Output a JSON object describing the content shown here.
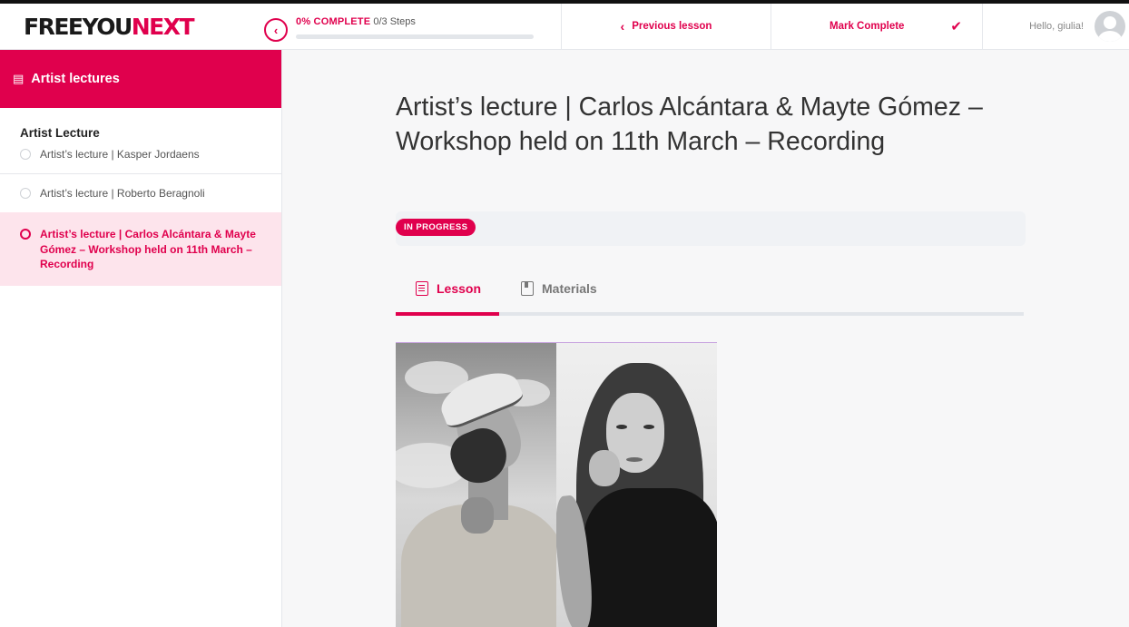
{
  "brand": {
    "logo_part1": "FREEYOU",
    "logo_part2": "NEXT"
  },
  "header": {
    "progress_percent_label": "0% COMPLETE",
    "progress_steps": "0/3 Steps",
    "progress_value": 0,
    "previous_label": "Previous lesson",
    "previous_icon": "chevron-left-icon",
    "mark_complete_label": "Mark Complete",
    "mark_complete_icon": "check-icon",
    "greeting": "Hello, giulia!",
    "avatar_icon": "user-avatar-icon"
  },
  "sidebar": {
    "header_title": "Artist lectures",
    "header_icon": "document-icon",
    "collapse_icon": "chevron-left-icon",
    "section_title": "Artist Lecture",
    "items": [
      {
        "label": "Artist’s lecture | Kasper Jordaens",
        "active": false
      },
      {
        "label": "Artist’s lecture | Roberto Beragnoli",
        "active": false
      },
      {
        "label": "Artist’s lecture | Carlos Alcántara & Mayte Gómez – Workshop held on 11th March – Recording",
        "active": true
      }
    ]
  },
  "main": {
    "title": "Artist’s lecture | Carlos Alcántara & Mayte Gómez – Workshop held on 11th March – Recording",
    "status_badge": "IN PROGRESS",
    "tabs": [
      {
        "label": "Lesson",
        "icon": "document-icon",
        "active": true
      },
      {
        "label": "Materials",
        "icon": "bookmark-icon",
        "active": false
      }
    ],
    "image_icon": "artist-photo"
  },
  "colors": {
    "accent": "#e0004d",
    "accent_light": "#fde4ec",
    "background": "#f7f7f8",
    "divider": "#e5e7eb"
  }
}
